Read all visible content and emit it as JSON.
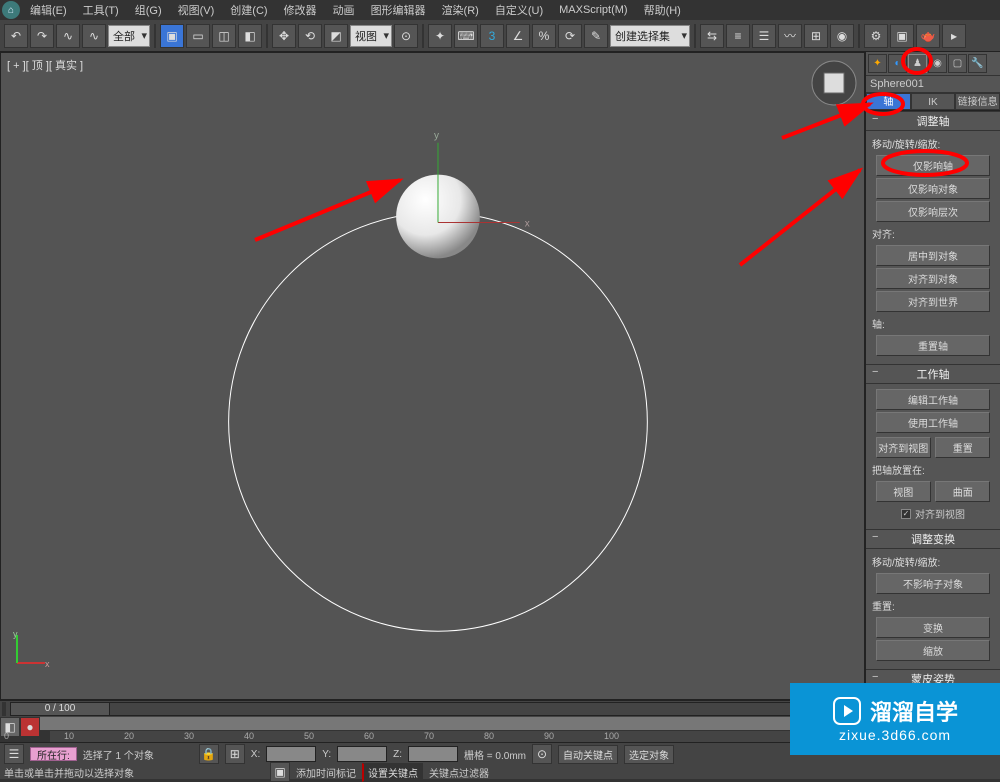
{
  "menubar": {
    "items": [
      "编辑(E)",
      "工具(T)",
      "组(G)",
      "视图(V)",
      "创建(C)",
      "修改器",
      "动画",
      "图形编辑器",
      "渲染(R)",
      "自定义(U)",
      "MAXScript(M)",
      "帮助(H)"
    ]
  },
  "toolbar": {
    "dropdown_all": "全部",
    "dropdown_view": "视图",
    "dropdown_selset": "创建选择集"
  },
  "viewport": {
    "label": "[ + ][ 顶 ][ 真实 ]",
    "axis_y": "y",
    "axis_x": "x"
  },
  "panel": {
    "object_name": "Sphere001",
    "tabs": {
      "pivot": "轴",
      "ik": "IK",
      "linkinfo": "链接信息"
    },
    "rollouts": {
      "adjust_pivot": {
        "title": "调整轴",
        "move_label": "移动/旋转/缩放:",
        "affect_pivot": "仅影响轴",
        "affect_object": "仅影响对象",
        "affect_hierarchy": "仅影响层次",
        "align_label": "对齐:",
        "center_object": "居中到对象",
        "align_object": "对齐到对象",
        "align_world": "对齐到世界",
        "pivot_label": "轴:",
        "reset_pivot": "重置轴"
      },
      "working_pivot": {
        "title": "工作轴",
        "edit_wp": "编辑工作轴",
        "use_wp": "使用工作轴",
        "align_view": "对齐到视图",
        "reset": "重置",
        "place_label": "把轴放置在:",
        "view": "视图",
        "surface": "曲面",
        "align_to_view_chk": "对齐到视图"
      },
      "adjust_xform": {
        "title": "调整变换",
        "move_label": "移动/旋转/缩放:",
        "no_affect_children": "不影响子对象",
        "reset_label": "重置:",
        "transform": "变换",
        "scale": "缩放"
      },
      "skin_pose": {
        "title": "蒙皮姿势"
      }
    }
  },
  "timeslider": {
    "frame": "0 / 100"
  },
  "timeline": {
    "ticks": [
      "0",
      "10",
      "20",
      "30",
      "40",
      "50",
      "60",
      "70",
      "80",
      "90",
      "100"
    ]
  },
  "status": {
    "current_field": "所在行:",
    "selection": "选择了 1 个对象",
    "prompt": "单击或单击并拖动以选择对象",
    "x_label": "X:",
    "x_val": "",
    "y_label": "Y:",
    "y_val": "",
    "z_label": "Z:",
    "z_val": "",
    "grid": "栅格 = 0.0mm",
    "autokey": "自动关键点",
    "selset": "选定对象",
    "add_time": "添加时间标记",
    "set_key": "设置关键点",
    "keyfilter": "关键点过滤器"
  },
  "watermark": {
    "name": "溜溜自学",
    "url": "zixue.3d66.com"
  }
}
